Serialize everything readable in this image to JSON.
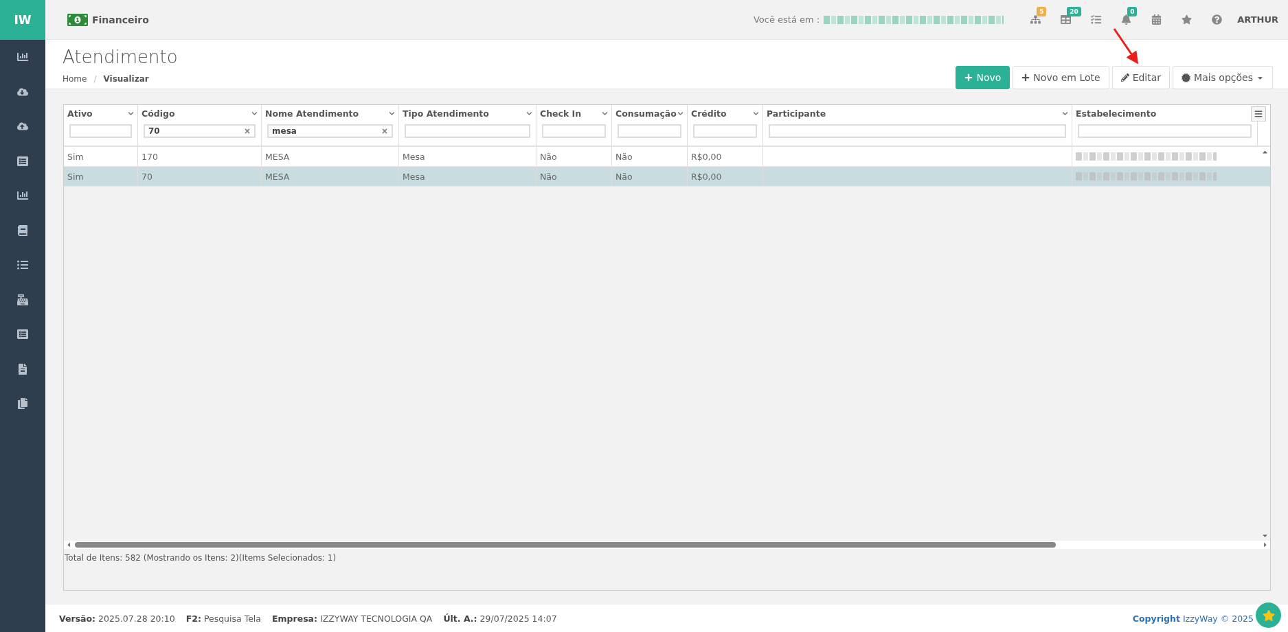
{
  "sidebar": {
    "logo": "IW"
  },
  "topbar": {
    "module": "Financeiro",
    "location_label": "Você está em :",
    "icons": [
      {
        "kind": "sitemap",
        "badge": "5",
        "color": "#f0ad4e"
      },
      {
        "kind": "table",
        "badge": "20",
        "color": "#2bb195"
      },
      {
        "kind": "tasks"
      },
      {
        "kind": "bell",
        "badge": "0",
        "color": "#2bb195"
      },
      {
        "kind": "calendar"
      },
      {
        "kind": "star"
      },
      {
        "kind": "help"
      }
    ],
    "user": "ARTHUR"
  },
  "page": {
    "title": "Atendimento",
    "breadcrumb_separator": "/",
    "breadcrumb": [
      {
        "label": "Home",
        "current": false
      },
      {
        "label": "Visualizar",
        "current": true
      }
    ]
  },
  "actions": [
    {
      "kind": "primary",
      "label": "Novo"
    },
    {
      "kind": "plus",
      "label": "Novo em Lote"
    },
    {
      "kind": "edit",
      "label": "Editar"
    },
    {
      "kind": "dropdown",
      "label": "Mais opções"
    }
  ],
  "table": {
    "columns": [
      {
        "label": "Ativo"
      },
      {
        "label": "Código",
        "filter": "70"
      },
      {
        "label": "Nome Atendimento",
        "filter": "mesa"
      },
      {
        "label": "Tipo Atendimento"
      },
      {
        "label": "Check In"
      },
      {
        "label": "Consumação"
      },
      {
        "label": "Crédito"
      },
      {
        "label": "Participante"
      },
      {
        "label": "Estabelecimento"
      }
    ],
    "rows": [
      {
        "selected": false,
        "cells": [
          "Sim",
          "170",
          "MESA",
          "Mesa",
          "Não",
          "Não",
          "R$0,00"
        ]
      },
      {
        "selected": true,
        "cells": [
          "Sim",
          "70",
          "MESA",
          "Mesa",
          "Não",
          "Não",
          "R$0,00"
        ]
      }
    ],
    "status": "Total de Itens: 582 (Mostrando os Itens: 2)(Items Selecionados: 1)"
  },
  "footer": {
    "items": [
      "**Versão:** 2025.07.28 20:10",
      "**F2:** Pesquisa Tela",
      "**Empresa:** IZZYWAY TECNOLOGIA QA",
      "**Últ. A.:** 29/07/2025 14:07"
    ],
    "copyright": "**Copyright** IzzyWay © 2025"
  }
}
